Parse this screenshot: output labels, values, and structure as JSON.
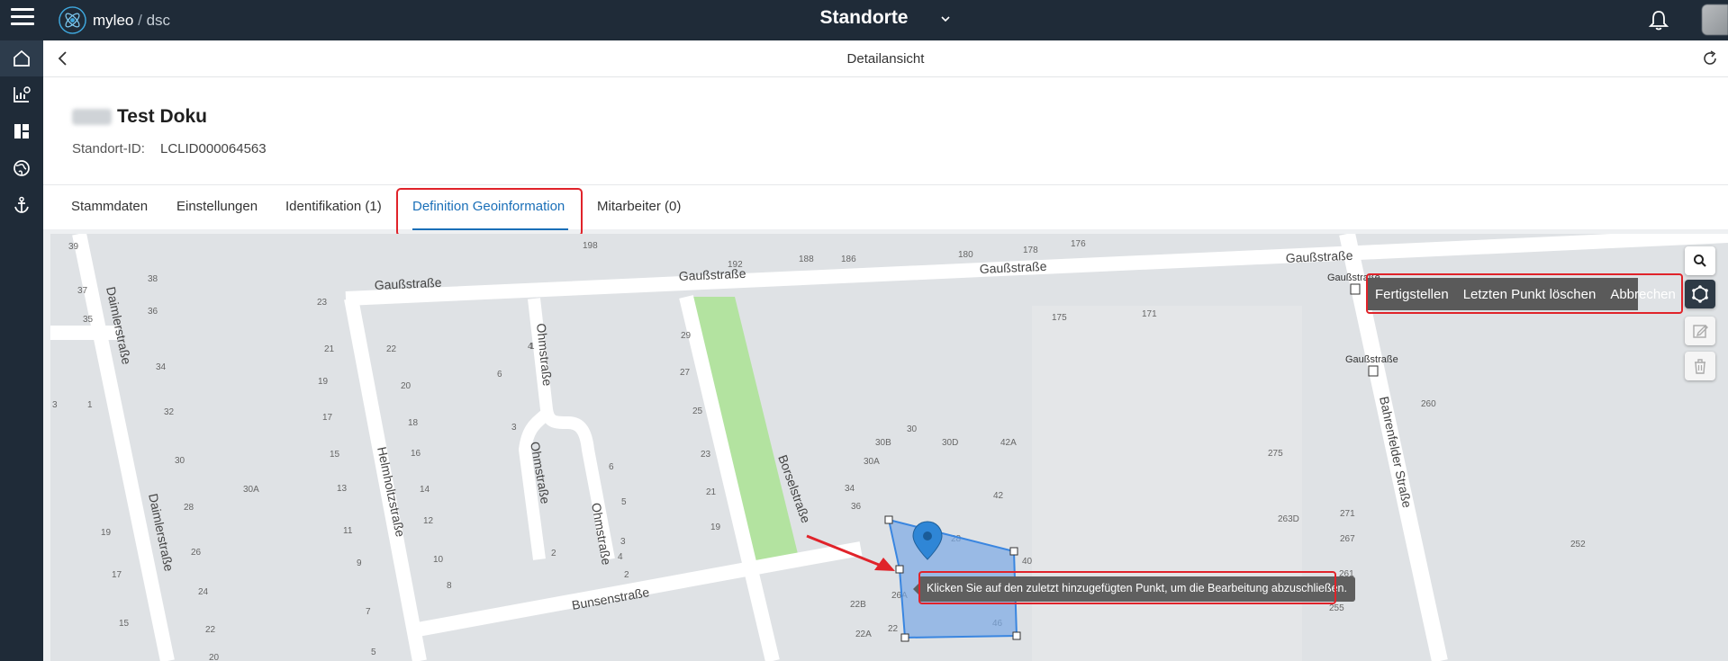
{
  "app": {
    "brand_name": "myleo",
    "brand_slash": "/",
    "brand_suffix": "dsc",
    "page_title": "Standorte"
  },
  "subheader": {
    "title": "Detailansicht"
  },
  "location": {
    "name": "Test Doku",
    "id_label": "Standort-ID:",
    "id_value": "LCLID000064563"
  },
  "tabs": [
    {
      "label": "Stammdaten"
    },
    {
      "label": "Einstellungen"
    },
    {
      "label": "Identifikation (1)"
    },
    {
      "label": "Definition Geoinformation"
    },
    {
      "label": "Mitarbeiter (0)"
    }
  ],
  "map": {
    "draw_toolbar": {
      "finish": "Fertigstellen",
      "delete_last": "Letzten Punkt löschen",
      "cancel": "Abbrechen"
    },
    "tooltip": "Klicken Sie auf den zuletzt hinzugefügten Punkt, um die Bearbeitung abzuschließen.",
    "streets": {
      "gauss": "Gaußstraße",
      "daimler": "Daimlerstraße",
      "ohms": "Ohmstraße",
      "helmholtz": "Helmholtzstraße",
      "borsel": "Borselstraße",
      "bunsen": "Bunsenstraße",
      "bahrenfelder": "Bahrenfelder Straße",
      "bus_stop": "Gaußstraße"
    },
    "house_numbers": [
      "39",
      "38",
      "37",
      "36",
      "35",
      "34",
      "198",
      "192",
      "188",
      "186",
      "180",
      "178",
      "176",
      "23",
      "22",
      "21",
      "20",
      "19",
      "18",
      "17",
      "16",
      "15",
      "14",
      "13",
      "12",
      "11",
      "10",
      "9",
      "8",
      "7",
      "6",
      "5",
      "4",
      "3",
      "2",
      "1",
      "29",
      "27",
      "25",
      "23",
      "21",
      "19",
      "175",
      "171",
      "30B",
      "30",
      "30D",
      "42A",
      "30A",
      "34",
      "36",
      "42",
      "28",
      "40",
      "26A",
      "46",
      "22B",
      "22A",
      "22",
      "260",
      "275",
      "263D",
      "271",
      "267",
      "261",
      "255",
      "252",
      "3",
      "1",
      "32",
      "30",
      "28",
      "26",
      "24",
      "22",
      "20",
      "19",
      "17",
      "15",
      "30A",
      "6",
      "5",
      "4",
      "3",
      "2"
    ],
    "colors": {
      "polygon": "#7aa9e6",
      "marker": "#2f86d6",
      "park": "#b3e3a0",
      "highlight": "#e0232a"
    }
  },
  "icons": {
    "menu": "hamburger-icon",
    "logo": "atom-logo-icon",
    "notifications": "bell-icon",
    "back": "chevron-left-icon",
    "refresh": "refresh-icon",
    "search": "search-icon",
    "polygon": "polygon-draw-icon",
    "edit": "edit-icon",
    "delete": "trash-icon"
  }
}
